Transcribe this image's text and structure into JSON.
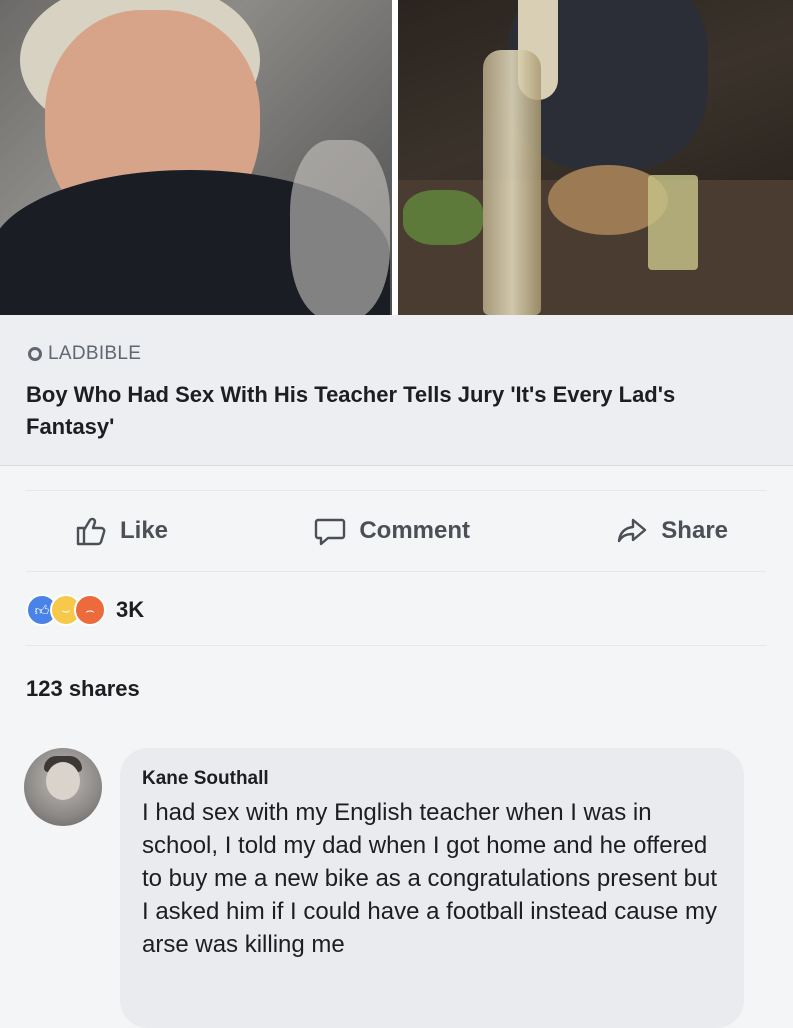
{
  "link_preview": {
    "source": "LADBIBLE",
    "headline": "Boy Who Had Sex With His Teacher Tells Jury 'It's Every Lad's Fantasy'"
  },
  "actions": {
    "like_label": "Like",
    "comment_label": "Comment",
    "share_label": "Share"
  },
  "reactions": {
    "types": [
      "like",
      "haha",
      "angry"
    ],
    "count": "3K"
  },
  "shares_text": "123 shares",
  "comment": {
    "author": "Kane Southall",
    "text": "I had sex with my English teacher when I was in school, I told my dad when I got home and he offered to buy me a new bike as a congratulations present but I asked him if I could have a football instead cause my arse was killing me"
  },
  "colors": {
    "like_blue": "#4a83e8",
    "haha_yellow": "#f7c94a",
    "angry_orange": "#ec6a3c"
  }
}
